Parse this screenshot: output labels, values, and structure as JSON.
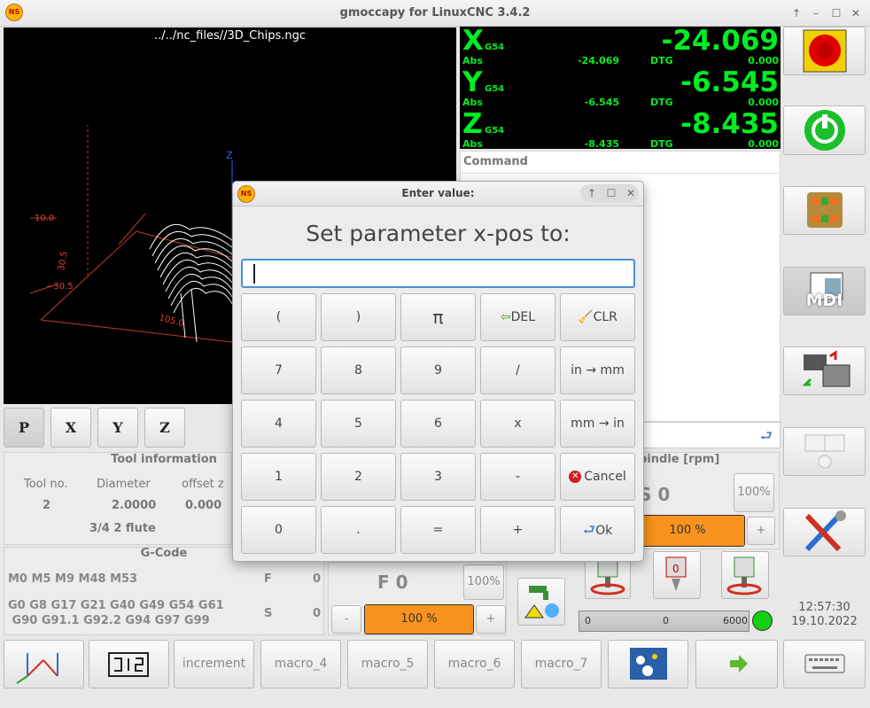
{
  "window": {
    "title": "gmoccapy for LinuxCNC  3.4.2",
    "controls": [
      "↑",
      "–",
      "☐",
      "✕"
    ]
  },
  "preview": {
    "filename": "../../nc_files//3D_Chips.ngc",
    "dims": [
      "10.0",
      "30.5",
      "−30.5",
      "105.0",
      "Z"
    ]
  },
  "view_buttons": [
    "P",
    "X",
    "Y",
    "Z"
  ],
  "dro": {
    "axes": [
      {
        "axis": "X",
        "coord": "G54",
        "value": "-24.069",
        "abs_label": "Abs",
        "abs": "-24.069",
        "dtg_label": "DTG",
        "dtg": "0.000"
      },
      {
        "axis": "Y",
        "coord": "G54",
        "value": "-6.545",
        "abs_label": "Abs",
        "abs": "-6.545",
        "dtg_label": "DTG",
        "dtg": "0.000"
      },
      {
        "axis": "Z",
        "coord": "G54",
        "value": "-8.435",
        "abs_label": "Abs",
        "abs": "-8.435",
        "dtg_label": "DTG",
        "dtg": "0.000"
      }
    ]
  },
  "command": {
    "label": "Command"
  },
  "tool": {
    "title": "Tool information",
    "headers": [
      "Tool no.",
      "Diameter",
      "offset z"
    ],
    "values": [
      "2",
      "2.0000",
      "0.000"
    ],
    "desc": "3/4 2 flute"
  },
  "gcode": {
    "title": "G-Code",
    "line1": "M0 M5 M9 M48 M53",
    "line2": "G0 G8 G17 G21 G40 G49 G54 G61",
    "line3": " G90 G91.1 G92.2 G94 G97 G99",
    "f_label": "F",
    "f_val": "0",
    "s_label": "S",
    "s_val": "0"
  },
  "feed": {
    "label": "F  0",
    "pct": "100%",
    "bar_text": "100 %",
    "minus": "-",
    "plus": "+",
    "level": 1.0
  },
  "spindle": {
    "title": "Spindle [rpm]",
    "title_visible": "pindle [rpm]",
    "s_text": "S 0",
    "pct": "100%",
    "bar_text": "100 %",
    "plus": "+",
    "gauge_min": "0",
    "gauge_mid": "0",
    "gauge_max": "6000",
    "level": 1.0
  },
  "clock": {
    "time": "12:57:30",
    "date": "19.10.2022"
  },
  "dialog": {
    "title": "Enter value:",
    "prompt": "Set parameter x-pos to:",
    "input_value": "",
    "keys": [
      [
        "(",
        ")",
        "π",
        "DEL",
        "CLR"
      ],
      [
        "7",
        "8",
        "9",
        "/",
        "in → mm"
      ],
      [
        "4",
        "5",
        "6",
        "x",
        "mm → in"
      ],
      [
        "1",
        "2",
        "3",
        "-",
        "Cancel"
      ],
      [
        "0",
        ".",
        "=",
        "+",
        "Ok"
      ]
    ]
  },
  "bottom": {
    "buttons": [
      "increment",
      "macro_4",
      "macro_5",
      "macro_6",
      "macro_7"
    ]
  },
  "side": {
    "mdi_label": "MDI"
  },
  "colors": {
    "dro_green": "#00ee22",
    "accent_orange": "#f7931e",
    "estop_red": "#e00000"
  }
}
